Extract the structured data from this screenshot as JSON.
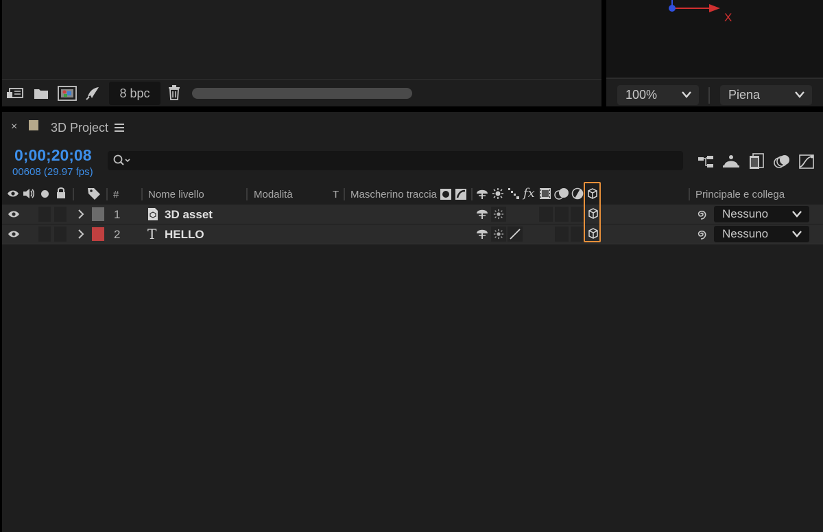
{
  "project_panel": {
    "bpc_label": "8 bpc",
    "icons": [
      "interpret-footage-icon",
      "folder-icon",
      "composition-icon",
      "render-queue-icon",
      "trash-icon"
    ]
  },
  "viewer_panel": {
    "axis_x_label": "X",
    "zoom": "100%",
    "resolution": "Piena"
  },
  "timeline": {
    "tab_label": "3D Project",
    "tab_color": "#b5a88a",
    "timecode": "0;00;20;08",
    "frame_info": "00608 (29.97 fps)",
    "columns": {
      "number": "#",
      "layer_name": "Nome livello",
      "mode": "Modalità",
      "t": "T",
      "track_matte": "Mascherino traccia",
      "fx": "fx",
      "parent": "Principale e collega"
    },
    "layers": [
      {
        "number": "1",
        "name": "3D asset",
        "label_color": "#6b6b6b",
        "type_icon": "3d-asset-icon",
        "parent": "Nessuno"
      },
      {
        "number": "2",
        "name": "HELLO",
        "label_color": "#c04040",
        "type_icon": "T",
        "parent": "Nessuno"
      }
    ],
    "accent_color": "#3d8fea",
    "highlight_color": "#e8903a"
  }
}
